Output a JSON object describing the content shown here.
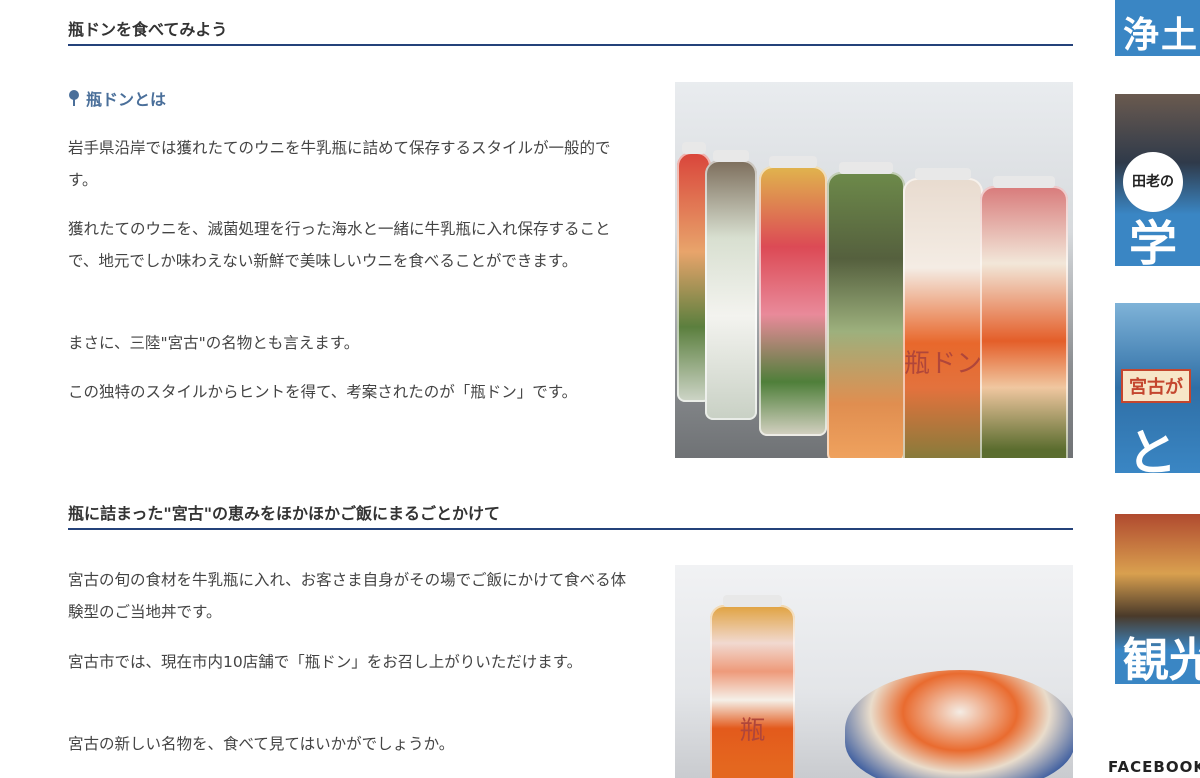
{
  "section1": {
    "heading": "瓶ドンを食べてみよう",
    "subheading": "瓶ドンとは",
    "paragraphs": [
      "岩手県沿岸では獲れたてのウニを牛乳瓶に詰めて保存するスタイルが一般的です。",
      "獲れたてのウニを、滅菌処理を行った海水と一緒に牛乳瓶に入れ保存することで、地元でしか味わえない新鮮で美味しいウニを食べることができます。",
      "まさに、三陸\"宮古\"の名物とも言えます。",
      "この独特のスタイルからヒントを得て、考案されたのが「瓶ドン」です。"
    ],
    "image_kanji": "瓶ドン"
  },
  "section2": {
    "heading": "瓶に詰まった\"宮古\"の恵みをほかほかご飯にまるごとかけて",
    "paragraphs": [
      "宮古の旬の食材を牛乳瓶に入れ、お客さま自身がその場でご飯にかけて食べる体験型のご当地丼です。",
      "宮古市では、現在市内10店舗で「瓶ドン」をお召し上がりいただけます。",
      "宮古の新しい名物を、食べて見てはいかがでしょうか。"
    ],
    "image_kanji": "瓶"
  },
  "sidebar": {
    "banner1_text": "浄土",
    "banner2_small": "田老の",
    "banner2_text": "学",
    "banner3_small": "宮古が",
    "banner3_text": "と",
    "banner4_text": "観光",
    "facebook_label": "FACEBOOK"
  },
  "colors": {
    "heading_rule": "#24427a",
    "subheading": "#4a6f9a",
    "banner_blue": "#3a86c4"
  }
}
